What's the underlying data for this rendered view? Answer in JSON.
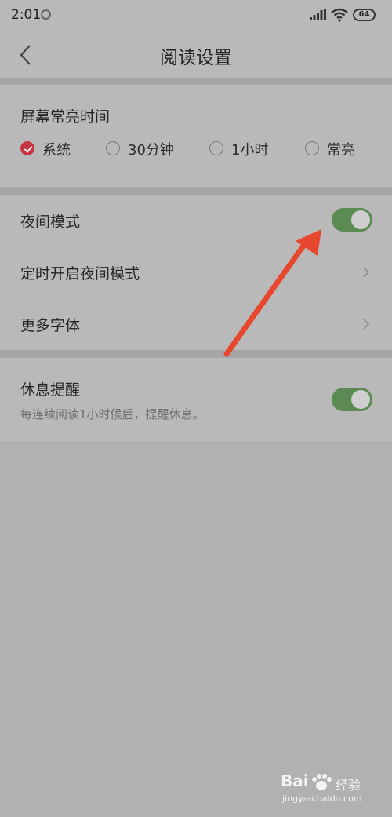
{
  "status_bar": {
    "time": "2:01",
    "battery": "64"
  },
  "header": {
    "title": "阅读设置",
    "back_icon": "chevron-left-icon"
  },
  "screen_on": {
    "title": "屏幕常亮时间",
    "options": [
      {
        "label": "系统",
        "checked": true
      },
      {
        "label": "30分钟",
        "checked": false
      },
      {
        "label": "1小时",
        "checked": false
      },
      {
        "label": "常亮",
        "checked": false
      }
    ]
  },
  "night_mode": {
    "label": "夜间模式",
    "enabled": true
  },
  "scheduled_night": {
    "label": "定时开启夜间模式"
  },
  "more_fonts": {
    "label": "更多字体"
  },
  "rest_reminder": {
    "label": "休息提醒",
    "description": "每连续阅读1小时候后，提醒休息。",
    "enabled": true
  },
  "watermark": {
    "brand": "Bai",
    "brand_suffix": "经验",
    "url": "jingyan.baidu.com"
  },
  "colors": {
    "accent_red": "#c6353f",
    "toggle_on": "#5b8b53",
    "annotation_arrow": "#e8472f"
  }
}
